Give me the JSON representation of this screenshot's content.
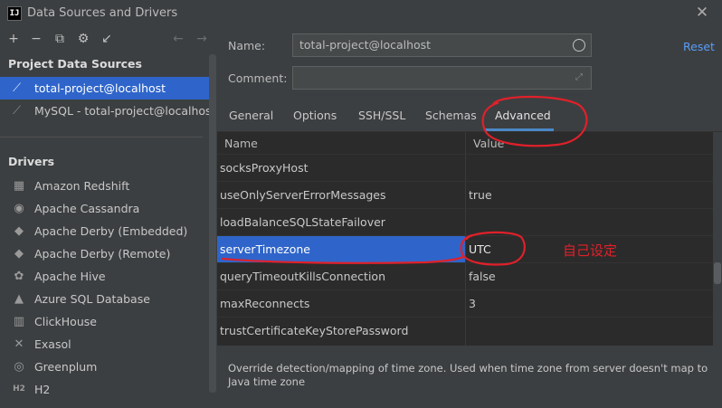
{
  "window": {
    "title": "Data Sources and Drivers",
    "logo_text": "IJ"
  },
  "toolbar": {
    "add": "+",
    "remove": "−",
    "duplicate": "⧉",
    "settings": "⚙",
    "import": "↙",
    "back": "←",
    "forward": "→"
  },
  "left": {
    "project_title": "Project Data Sources",
    "data_sources": [
      {
        "label": "total-project@localhost",
        "selected": true
      },
      {
        "label": "MySQL - total-project@localhost",
        "selected": false
      }
    ],
    "drivers_title": "Drivers",
    "drivers": [
      {
        "label": "Amazon Redshift",
        "icon": "redshift-icon",
        "glyph": "▦"
      },
      {
        "label": "Apache Cassandra",
        "icon": "cassandra-icon",
        "glyph": "◉"
      },
      {
        "label": "Apache Derby (Embedded)",
        "icon": "derby-icon",
        "glyph": "◆"
      },
      {
        "label": "Apache Derby (Remote)",
        "icon": "derby-icon",
        "glyph": "◆"
      },
      {
        "label": "Apache Hive",
        "icon": "hive-icon",
        "glyph": "✿"
      },
      {
        "label": "Azure SQL Database",
        "icon": "azure-icon",
        "glyph": "▲"
      },
      {
        "label": "ClickHouse",
        "icon": "clickhouse-icon",
        "glyph": "▥"
      },
      {
        "label": "Exasol",
        "icon": "exasol-icon",
        "glyph": "✕"
      },
      {
        "label": "Greenplum",
        "icon": "greenplum-icon",
        "glyph": "◎"
      },
      {
        "label": "H2",
        "icon": "h2-icon",
        "glyph": "H2"
      }
    ]
  },
  "form": {
    "name_label": "Name:",
    "name_value": "total-project@localhost",
    "comment_label": "Comment:",
    "comment_value": "",
    "reset": "Reset"
  },
  "tabs": [
    "General",
    "Options",
    "SSH/SSL",
    "Schemas",
    "Advanced"
  ],
  "table": {
    "headers": {
      "name": "Name",
      "value": "Value"
    },
    "rows": [
      {
        "name": "socksProxyHost",
        "value": ""
      },
      {
        "name": "useOnlyServerErrorMessages",
        "value": "true"
      },
      {
        "name": "loadBalanceSQLStateFailover",
        "value": ""
      },
      {
        "name": "serverTimezone",
        "value": "UTC"
      },
      {
        "name": "queryTimeoutKillsConnection",
        "value": "false"
      },
      {
        "name": "maxReconnects",
        "value": "3"
      },
      {
        "name": "trustCertificateKeyStorePassword",
        "value": ""
      }
    ]
  },
  "description": "Override detection/mapping of time zone. Used when time zone from server doesn't map to Java time zone",
  "annotation": {
    "note": "自己设定",
    "color": "#e0202a"
  },
  "colors": {
    "selection": "#2f65ca",
    "link": "#589df6",
    "tab_underline": "#4a88c7"
  }
}
